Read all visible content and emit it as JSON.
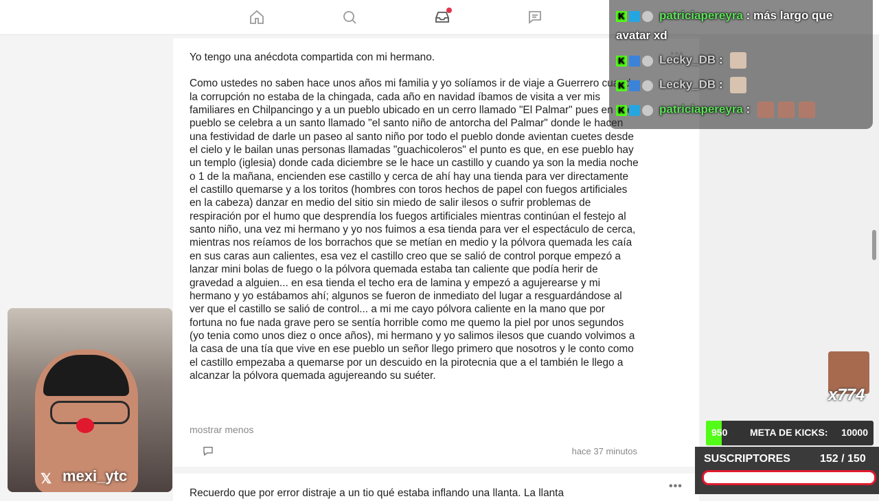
{
  "nav": {
    "icons": [
      "home-icon",
      "search-icon",
      "inbox-icon",
      "chat-icon"
    ],
    "inbox_has_notification": true
  },
  "post": {
    "paragraph1": "Yo tengo una anécdota compartida con mi hermano.",
    "paragraph2": "Como ustedes no saben hace unos años mi familia y yo solíamos ir de viaje a Guerrero cuando la corrupción no estaba de la chingada, cada año en navidad íbamos de visita a ver mis familiares en Chilpancingo y a un pueblo ubicado en un cerro llamado \"El Palmar\" pues en ese pueblo se celebra a un santo llamado \"el santo niño de antorcha del Palmar\" donde le hacen una festividad de darle un paseo al santo niño por todo el pueblo donde avientan cuetes desde el cielo y le bailan unas personas llamadas \"guachicoleros\" el punto es que, en ese pueblo hay un templo (iglesia) donde cada diciembre se le hace un castillo y cuando ya son la media noche o 1 de la mañana, encienden ese castillo y cerca de ahí hay una tienda para ver directamente el castillo quemarse y a los toritos (hombres con toros hechos de papel con fuegos artificiales en la cabeza) danzar en medio del sitio sin miedo de salir ilesos o sufrir problemas de respiración por el humo que desprendía los fuegos artificiales mientras continúan el festejo al santo niño, una vez mi hermano y yo nos fuimos a esa tienda para ver el espectáculo de cerca, mientras nos reíamos de los borrachos que se metían en medio y la pólvora quemada les caía en sus caras aun calientes, esa vez el castillo creo que se salió de control porque empezó a lanzar mini bolas de fuego o la pólvora quemada estaba tan caliente que podía herir de gravedad a alguien... en esa tienda el techo era de lamina y empezó a agujerearse y mi hermano y yo estábamos ahí; algunos se fueron de inmediato del lugar a resguardándose al ver que el castillo se salió de control... a mi me cayo pólvora caliente en la mano que por fortuna no fue nada grave pero se sentía horrible como me quemo la piel por unos segundos (yo tenia como unos diez o once años), mi hermano y yo salimos ilesos que cuando volvimos a la casa de una tía que vive en ese pueblo un señor llego primero que nosotros y le conto como el castillo empezaba a quemarse por un descuido en la pirotecnia que a el también le llego a alcanzar la pólvora quemada agujereando su suéter.",
    "show_less": "mostrar menos",
    "time": "hace 37 minutos",
    "more_dots": "•••"
  },
  "next_post": {
    "text": "Recuerdo que por error distraje a un tio qué estaba inflando una llanta. La llanta",
    "more_dots": "•••"
  },
  "chat": {
    "messages": [
      {
        "user": "patriciapereyra",
        "sep": " : ",
        "text": "más largo que",
        "user_color": "#5ee15a"
      },
      {
        "user": "",
        "sep": "",
        "text": "avatar xd"
      },
      {
        "user": "Lecky_DB",
        "sep": " : ",
        "text": "",
        "user_color": "#d0d0d0"
      },
      {
        "user": "Lecky_DB",
        "sep": " : ",
        "text": "",
        "user_color": "#d0d0d0"
      },
      {
        "user": "patriciapereyra",
        "sep": " : ",
        "text": "",
        "user_color": "#5ee15a"
      }
    ],
    "badge_k": "K"
  },
  "webcam": {
    "x_logo": "𝕏",
    "handle": "mexi_ytc"
  },
  "overlay": {
    "multiplier": "x774",
    "kicks_current": "950",
    "kicks_label": "META DE KICKS:",
    "kicks_goal": "10000",
    "kicks_progress": 0.095,
    "subs_label": "SUSCRIPTORES",
    "subs_count": "152  / 150",
    "subs_progress": 1.0
  },
  "colors": {
    "kick_green": "#53fc18",
    "notification_red": "#e3344b",
    "subs_border": "#e0192e"
  }
}
